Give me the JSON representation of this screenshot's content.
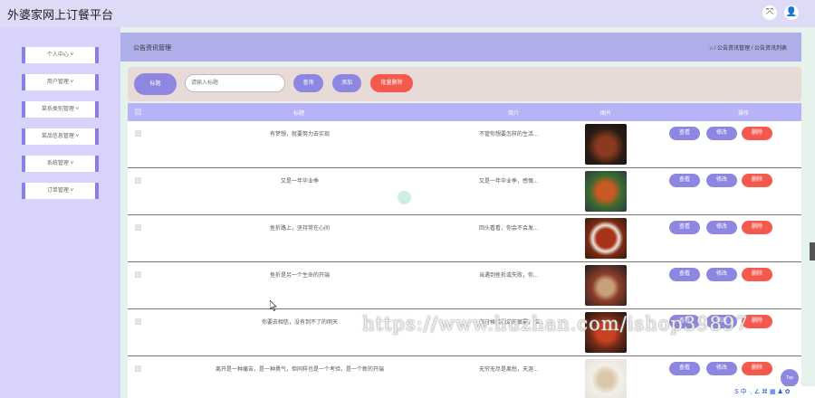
{
  "app": {
    "title": "外婆家网上订餐平台"
  },
  "top_icons": [
    "fullscreen-icon",
    "user-icon"
  ],
  "sidebar": {
    "items": [
      {
        "label": "个人中心 ˅"
      },
      {
        "label": "用户管理 ˅"
      },
      {
        "label": "菜系类别管理 ˅"
      },
      {
        "label": "菜品信息管理 ˅"
      },
      {
        "label": "系统管理 ˅"
      },
      {
        "label": "订单管理 ˅"
      }
    ]
  },
  "header": {
    "page_title": "公告资讯管理",
    "breadcrumb": "⌂ / 公告资讯管理 / 公告资讯列表"
  },
  "search": {
    "title_label": "标题",
    "placeholder": "请输入标题",
    "value": "",
    "query_label": "查询",
    "add_label": "添加",
    "batch_delete_label": "批量删除"
  },
  "table": {
    "columns": [
      "标题",
      "简介",
      "图片",
      "操作"
    ],
    "actions": {
      "view": "查看",
      "edit": "修改",
      "delete": "删除"
    },
    "rows": [
      {
        "title": "有梦想，就要努力去实现",
        "summary": "不管你想要怎样的生活..."
      },
      {
        "title": "又是一年毕业季",
        "summary": "又是一年毕业季，感慨..."
      },
      {
        "title": "挫折路上，坚持常在心间",
        "summary": "回头看看，你会不会发..."
      },
      {
        "title": "挫折是另一个生命的开端",
        "summary": "当遇到挫折或失败，你..."
      },
      {
        "title": "你要去相信，没有到不了的明天",
        "summary": "有时候我们走的很累，但..."
      },
      {
        "title": "离开是一种痛苦，是一种勇气，但同样也是一个考验，是一个新的开端",
        "summary": "无穷无尽是离愁，天涯..."
      }
    ]
  },
  "watermark": "https://www.huzhan.com/ishop39897",
  "top_button": {
    "label": "Top"
  },
  "ime_bar": {
    "label": "S 中 ·, ∠ ⌘ ▦ ♟ ✿"
  },
  "colors": {
    "accent": "#8e87e2",
    "danger": "#f5584d",
    "sidebar": "#d7d3fb",
    "header": "#aeaee9"
  }
}
